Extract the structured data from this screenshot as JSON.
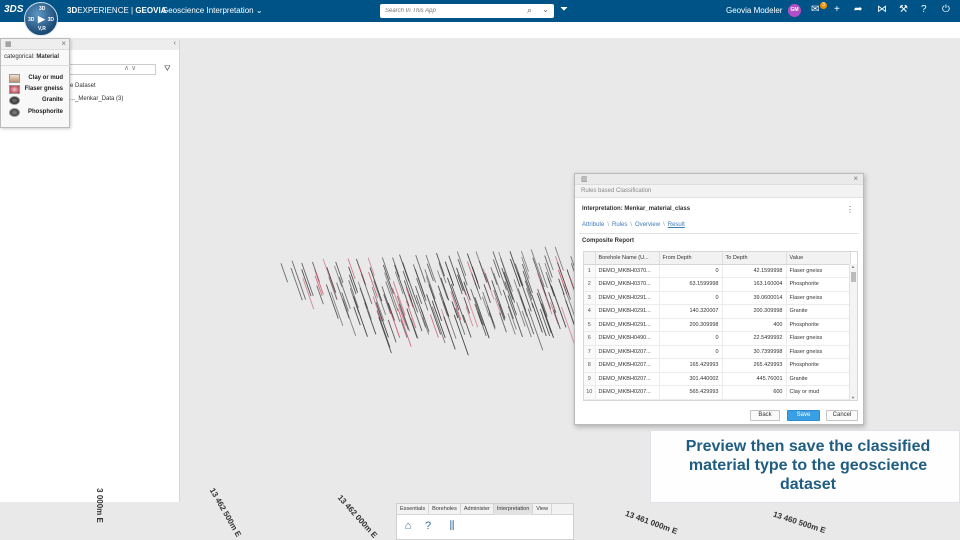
{
  "topbar": {
    "logo": "3DS",
    "compass": {
      "top": "3D",
      "left": "3D",
      "right": "3D",
      "bottom": "V,R"
    },
    "brand_prefix": "3D",
    "brand_main": "EXPERIENCE | ",
    "brand_geovia": "GEOVIA",
    "app_title": "Geoscience Interpretation",
    "search_placeholder": "Search In This App",
    "user_name": "Geovia Modeler",
    "user_initials": "GM",
    "notification_count": "3"
  },
  "left_panel": {
    "filter_placeholder": "...",
    "tree": [
      {
        "label": "...ce Dataset"
      },
      {
        "label": "..._Menkar_Data (3)"
      }
    ]
  },
  "legend": {
    "title_prefix": "categorical:",
    "title_attr": "Material",
    "items": [
      {
        "label": "Clay or mud",
        "color": "#d9b99b"
      },
      {
        "label": "Flaser gneiss",
        "color": "#c7505f"
      },
      {
        "label": "Granite",
        "color": "#2b2b2b"
      },
      {
        "label": "Phosphorite",
        "color": "#444444"
      }
    ]
  },
  "viewport": {
    "axis_labels": [
      "3 000m E",
      "13 462 500m E",
      "13 462 000m E",
      "13 461 000m E",
      "13 460 500m E"
    ]
  },
  "dialog": {
    "title": "Rules based Classification",
    "interpretation_label": "Interpretation:",
    "interpretation_value": "Menkar_material_class",
    "breadcrumb": [
      "Attribute",
      "Rules",
      "Overview",
      "Result"
    ],
    "report_title": "Composite Report",
    "columns": [
      "",
      "Borehole Name (U...",
      "From Depth",
      "To Depth",
      "Value"
    ],
    "rows": [
      {
        "idx": "1",
        "name": "DEMO_MKBH0370...",
        "from": "0",
        "to": "42.1599998",
        "value": "Flaser gneiss"
      },
      {
        "idx": "2",
        "name": "DEMO_MKBH0370...",
        "from": "63.1599998",
        "to": "163.160004",
        "value": "Phosphorite"
      },
      {
        "idx": "3",
        "name": "DEMO_MKBH0291...",
        "from": "0",
        "to": "39.0600014",
        "value": "Flaser gneiss"
      },
      {
        "idx": "4",
        "name": "DEMO_MKBH0291...",
        "from": "140.320007",
        "to": "200.309998",
        "value": "Granite"
      },
      {
        "idx": "5",
        "name": "DEMO_MKBH0291...",
        "from": "200.309998",
        "to": "400",
        "value": "Phosphorite"
      },
      {
        "idx": "6",
        "name": "DEMO_MKBH0490...",
        "from": "0",
        "to": "22.5499992",
        "value": "Flaser gneiss"
      },
      {
        "idx": "7",
        "name": "DEMO_MKBH0207...",
        "from": "0",
        "to": "30.7399998",
        "value": "Flaser gneiss"
      },
      {
        "idx": "8",
        "name": "DEMO_MKBH0207...",
        "from": "165.429993",
        "to": "265.429993",
        "value": "Phosphorite"
      },
      {
        "idx": "9",
        "name": "DEMO_MKBH0207...",
        "from": "301.440002",
        "to": "445.76001",
        "value": "Granite"
      },
      {
        "idx": "10",
        "name": "DEMO_MKBH0207...",
        "from": "565.429993",
        "to": "600",
        "value": "Clay or mud"
      }
    ],
    "buttons": {
      "back": "Back",
      "save": "Save",
      "cancel": "Cancel"
    }
  },
  "caption": "Preview then save the classified material type to the geoscience dataset",
  "actionbar": {
    "tabs": [
      "Essentials",
      "Boreholes",
      "Administer",
      "Interpretation",
      "View"
    ],
    "active_tab": "Interpretation"
  }
}
